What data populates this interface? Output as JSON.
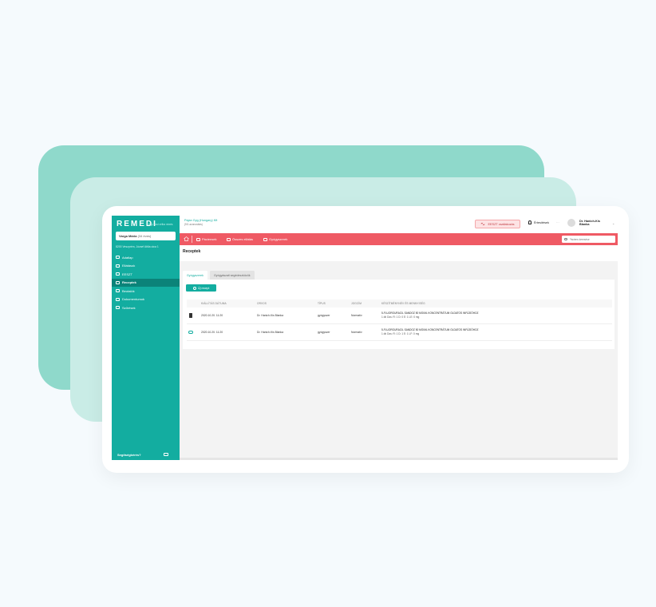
{
  "brand": {
    "logo": "REMEDI",
    "tagline": "Egy kicsi célba nézés"
  },
  "sidebar": {
    "patient_name": "Varga Mária",
    "patient_age": "(34 éves)",
    "patient_address": "8200 Veszprém, József Attila utca 1",
    "items": [
      {
        "label": "Adatlap",
        "icon": "profile-icon"
      },
      {
        "label": "Ellátások",
        "icon": "list-icon"
      },
      {
        "label": "EESZT",
        "icon": "eeszt-icon"
      },
      {
        "label": "Receptek",
        "icon": "prescription-icon"
      },
      {
        "label": "Beutalók",
        "icon": "referral-icon"
      },
      {
        "label": "Dokumentumok",
        "icon": "documents-icon"
      },
      {
        "label": "Szűrések",
        "icon": "screening-icon"
      }
    ],
    "help": "Segítségkérés?"
  },
  "header": {
    "pharmacy": "Pajan Gyg (Hungary) Kft",
    "pharmacy_sub": "(9/1 azonosítás)",
    "eeszt_button": "EESZT csatlakozás",
    "notifications": "Értesítések",
    "notifications_more": "···",
    "user_name": "Dr. Hanich-Kis Blanka"
  },
  "toolbar": {
    "items": [
      "Páciensek",
      "Összes ellátás",
      "Gyógyszerek"
    ],
    "search_placeholder": "Páciens keresése"
  },
  "page": {
    "title": "Receptek",
    "tabs": [
      "Gyógyszerek",
      "Gyógyászati segédeszközök"
    ],
    "new_button": "Új recept"
  },
  "table": {
    "columns": [
      "KIÁLLÍTÁS DÁTUMA",
      "ORVOS",
      "TÍPUS",
      "JOGCÍM",
      "KÉSZÍTMÉNYNÉV ÉS MENNYISÉG"
    ],
    "rows": [
      {
        "status_icon": "document-icon",
        "date": "2020.10.20. 11:20",
        "doctor": "Dr. Hanich-Kis Blanka",
        "type": "gyógyszer",
        "legal": "Normatív",
        "product": "5-FLUOROURACIL SANDOZ 50 MG/ML KONCENTRÁTUM OLDATOS INFÚZIÓHOZ",
        "dosage": "1 db Dos: R: 1 D: 0 E: 1 LE: 0 mg"
      },
      {
        "status_icon": "cloud-icon",
        "date": "2020.10.20. 11:20",
        "doctor": "Dr. Hanich-Kis Blanka",
        "type": "gyógyszer",
        "legal": "Normatív",
        "product": "5-FLUOROURACIL SANDOZ 50 MG/ML KONCENTRÁTUM OLDATOS INFÚZIÓHOZ",
        "dosage": "1 db Dos: R: 1 D: 1 E: 1 LF: 0 mg"
      }
    ]
  },
  "colors": {
    "teal": "#13ada0",
    "teal_dark": "#0b8379",
    "coral": "#ef5a64",
    "deco_back": "#8fd9cb",
    "deco_mid": "#c9ece6"
  }
}
